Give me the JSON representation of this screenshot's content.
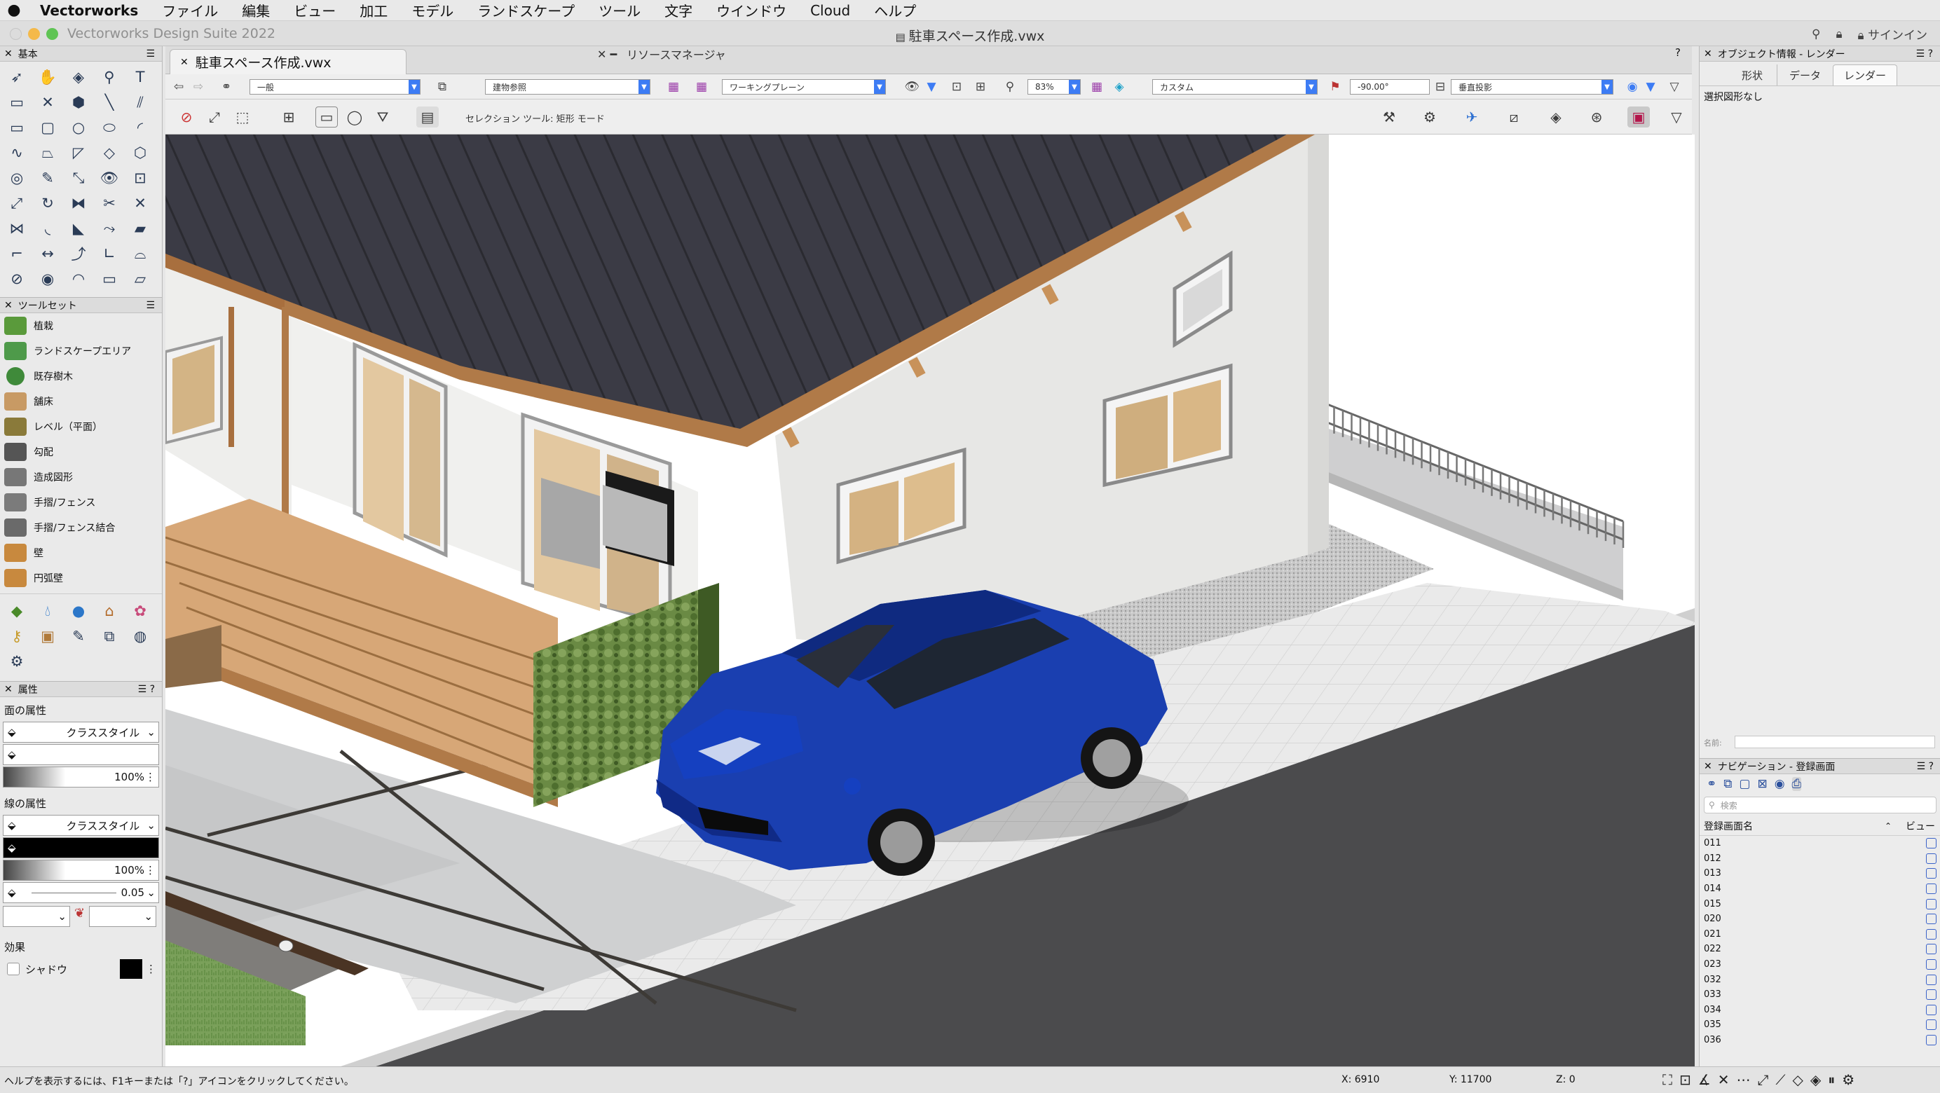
{
  "menubar": {
    "app": "Vectorworks",
    "items": [
      "ファイル",
      "編集",
      "ビュー",
      "加工",
      "モデル",
      "ランドスケープ",
      "ツール",
      "文字",
      "ウインドウ",
      "Cloud",
      "ヘルプ"
    ]
  },
  "window": {
    "app_title": "Vectorworks Design Suite 2022",
    "doc_title": "駐車スペース作成.vwx",
    "signin": "サインイン"
  },
  "doc_tab": {
    "label": "駐車スペース作成.vwx"
  },
  "resource_manager": {
    "title": "リソースマネージャ",
    "help": "?"
  },
  "viewbar": {
    "class": "一般",
    "layer": "建物参照",
    "plane": "ワーキングプレーン",
    "zoom": "83%",
    "view": "カスタム",
    "angle": "-90.00°",
    "projection": "垂直投影"
  },
  "modebar": {
    "mode_text": "セレクション ツール: 矩形 モード"
  },
  "panels": {
    "basic": {
      "title": "基本"
    },
    "toolsets": {
      "title": "ツールセット",
      "items": [
        "植栽",
        "ランドスケープエリア",
        "既存樹木",
        "舗床",
        "レベル（平面）",
        "勾配",
        "造成図形",
        "手摺/フェンス",
        "手摺/フェンス結合",
        "壁",
        "円弧壁"
      ]
    },
    "attributes": {
      "title": "属性",
      "fill_label": "面の属性",
      "fill_style": "クラススタイル",
      "fill_opacity": "100%",
      "line_label": "線の属性",
      "line_style": "クラススタイル",
      "line_opacity": "100%",
      "line_weight": "0.05",
      "effects_label": "効果",
      "shadow_label": "シャドウ"
    }
  },
  "objinfo": {
    "title": "オブジェクト情報 - レンダー",
    "tabs": [
      "形状",
      "データ",
      "レンダー"
    ],
    "active_tab": "レンダー",
    "empty": "選択図形なし",
    "name_label": "名前:"
  },
  "navigation": {
    "title": "ナビゲーション - 登録画面",
    "search_placeholder": "検索",
    "col_name": "登録画面名",
    "col_view": "ビュー",
    "rows": [
      "011",
      "012",
      "013",
      "014",
      "015",
      "020",
      "021",
      "022",
      "023",
      "032",
      "033",
      "034",
      "035",
      "036"
    ]
  },
  "status": {
    "help": "ヘルプを表示するには、F1キーまたは「?」アイコンをクリックしてください。",
    "x": "X: 6910",
    "y": "Y: 11700",
    "z": "Z: 0"
  },
  "colors": {
    "accent": "#3d7cf4",
    "car": "#1a3fb0",
    "roof": "#3a3a44",
    "deck": "#d7a777",
    "paving": "#e8e8e6",
    "asphalt": "#4a4a4c",
    "hedge": "#5b7b35"
  }
}
